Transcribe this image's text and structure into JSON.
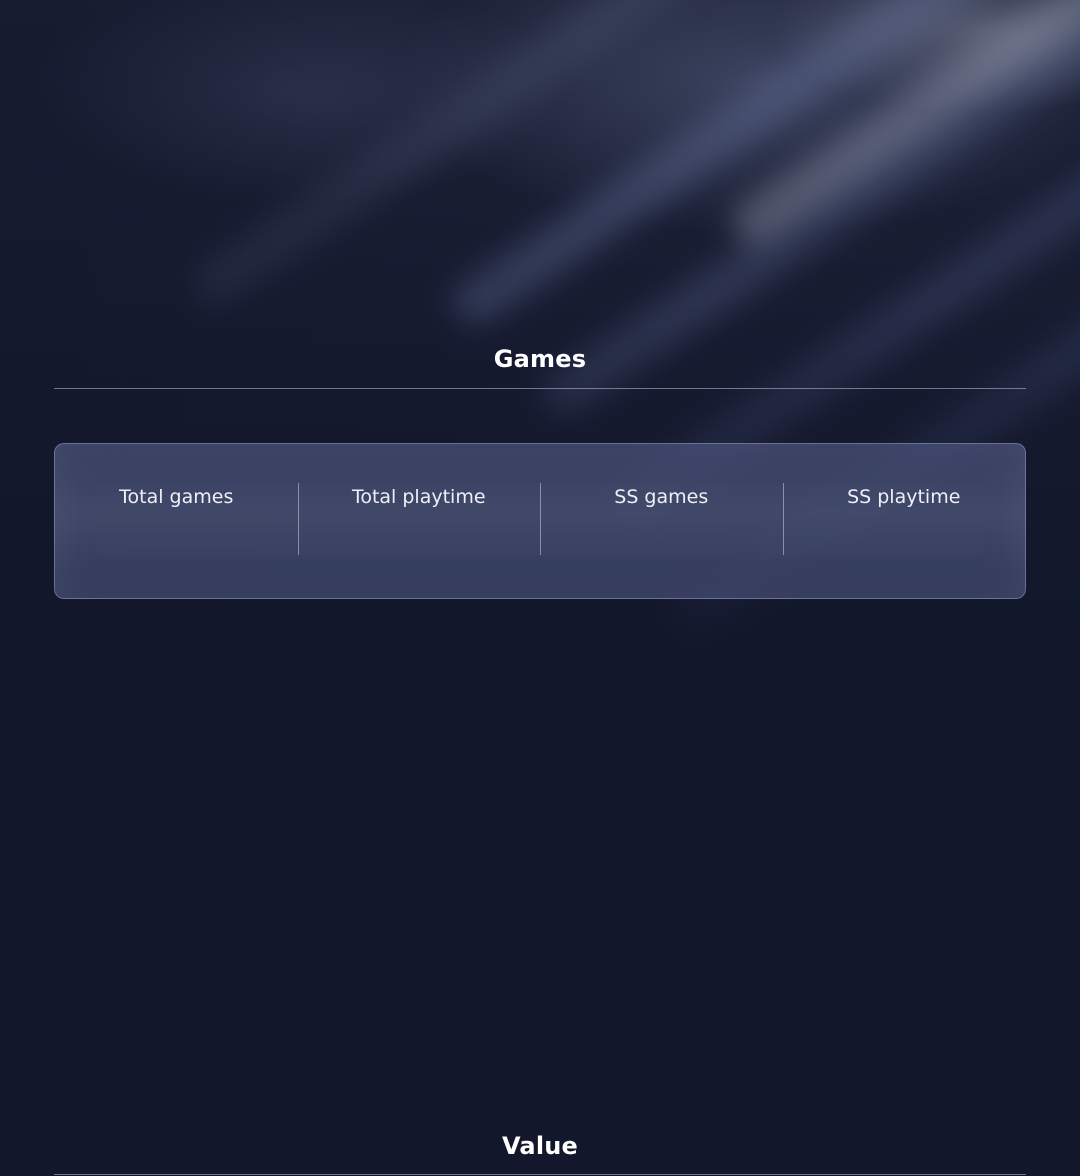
{
  "sections": {
    "games": {
      "title": "Games",
      "stats": [
        {
          "label": "Total games"
        },
        {
          "label": "Total playtime"
        },
        {
          "label": "SS games"
        },
        {
          "label": "SS playtime"
        }
      ]
    },
    "value": {
      "title": "Value"
    }
  },
  "colors": {
    "background": "#12172b",
    "card": "#4a5278",
    "text": "#ffffff"
  }
}
